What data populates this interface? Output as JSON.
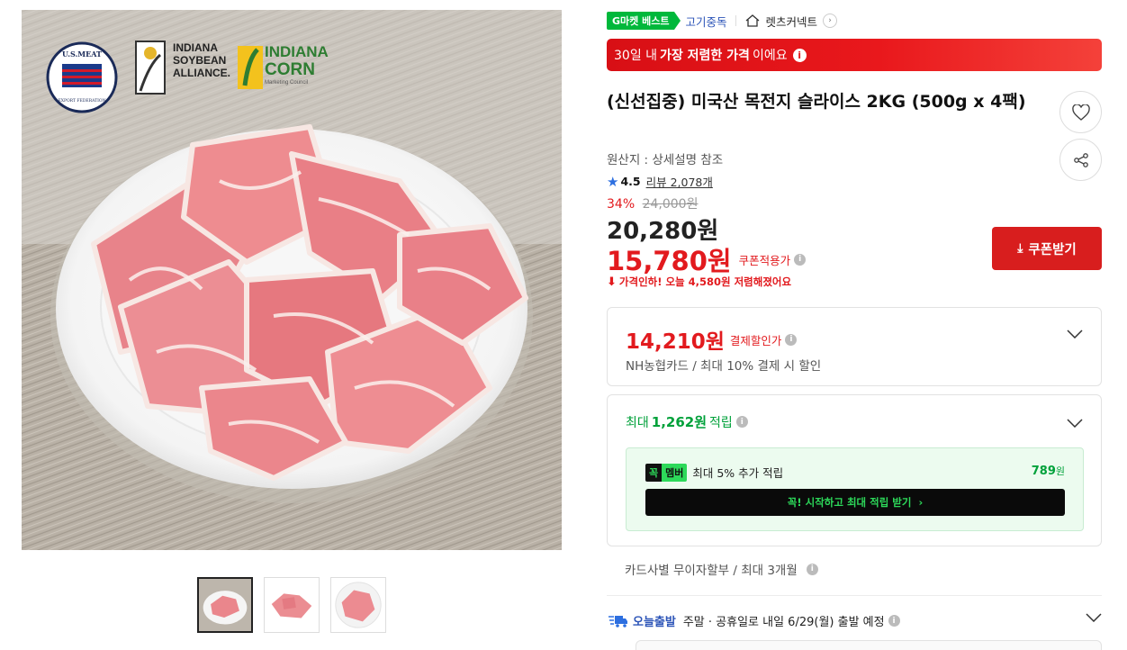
{
  "badges": {
    "best": "G마켓 베스트",
    "category": "고기중독",
    "store": "렛츠커넥트"
  },
  "banner": {
    "prefix": "30일 내",
    "bold": "가장 저렴한 가격",
    "suffix": "이에요"
  },
  "product": {
    "title": "(신선집중) 미국산 목전지 슬라이스 2KG (500g x 4팩)",
    "origin": "원산지 : 상세설명 참조",
    "rating": "4.5",
    "review": "리뷰 2,078개"
  },
  "price": {
    "discount_rate": "34%",
    "original": "24,000원",
    "sale": "20,280원",
    "coupon": "15,780원",
    "coupon_label": "쿠폰적용가",
    "drop_notice": "가격인하! 오늘 4,580원 저렴해졌어요",
    "coupon_button": "쿠폰받기"
  },
  "payment": {
    "price": "14,210원",
    "label": "결제할인가",
    "detail": "NH농협카드 / 최대 10% 결제 시 할인"
  },
  "reward": {
    "prefix": "최대",
    "amount": "1,262원",
    "suffix": "적립",
    "member_logo_a": "꼭",
    "member_logo_b": "멤버",
    "member_text": "최대 5% 추가 적립",
    "member_points": "789",
    "member_points_unit": "원",
    "cta": "꼭! 시작하고 최대 적립 받기"
  },
  "installment": "카드사별 무이자할부 / 최대 3개월",
  "shipping": {
    "tag": "오늘출발",
    "text": "주말 · 공휴일로 내일 6/29(월) 출발 예정"
  },
  "image_logos": {
    "usmeat_1": "U.S.MEAT",
    "usmeat_2": "EXPORT FEDERATION",
    "soybean_1": "INDIANA",
    "soybean_2": "SOYBEAN",
    "soybean_3": "ALLIANCE.",
    "corn_1": "INDIANA",
    "corn_2": "CORN",
    "corn_3": "Marketing Council"
  },
  "colors": {
    "brand_red": "#e21a1e",
    "brand_green": "#00b83b",
    "link_blue": "#2d55b8"
  }
}
